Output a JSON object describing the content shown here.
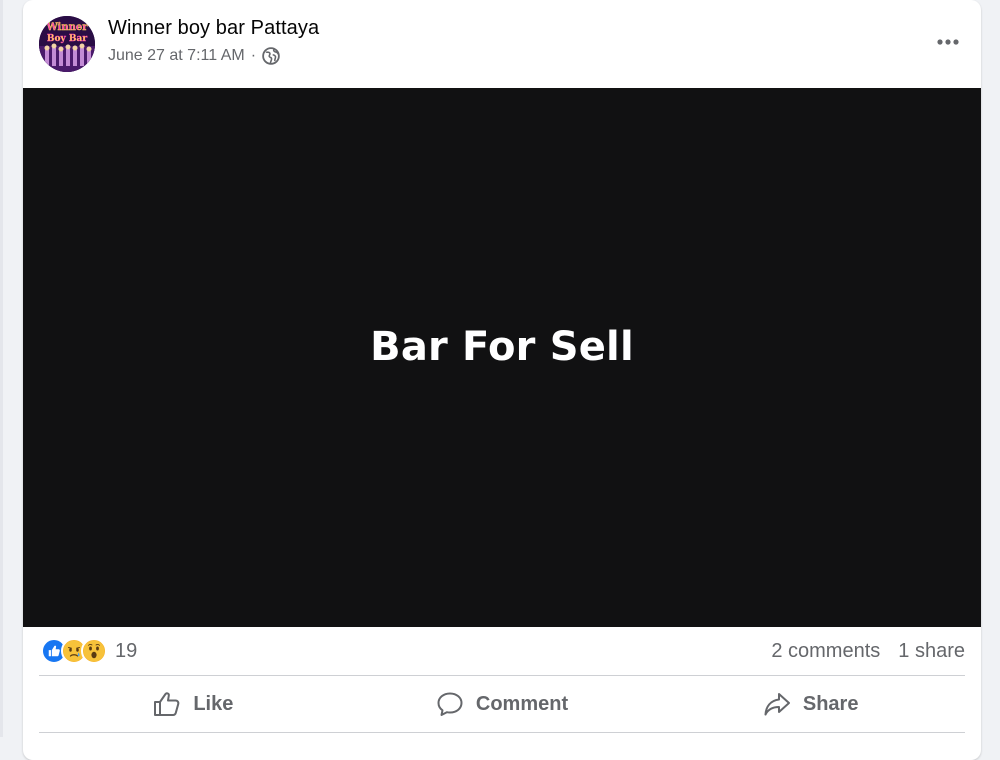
{
  "post": {
    "author": "Winner boy bar Pattaya",
    "timestamp": "June 27 at 7:11 AM",
    "separator": "·",
    "avatar_text_line1": "Winner",
    "avatar_text_line2": "Boy Bar",
    "visibility_icon": "globe-icon",
    "more_icon": "more-options-icon"
  },
  "media": {
    "text": "Bar For Sell",
    "background": "#111112"
  },
  "stats": {
    "reactions": [
      "like-reaction-icon",
      "sad-reaction-icon",
      "wow-reaction-icon"
    ],
    "reaction_count": "19",
    "comments": "2 comments",
    "shares": "1 share"
  },
  "actions": {
    "like": "Like",
    "comment": "Comment",
    "share": "Share"
  },
  "colors": {
    "like_blue": "#1877f2",
    "emoji_yellow": "#f7b125",
    "secondary_text": "#65676b"
  }
}
